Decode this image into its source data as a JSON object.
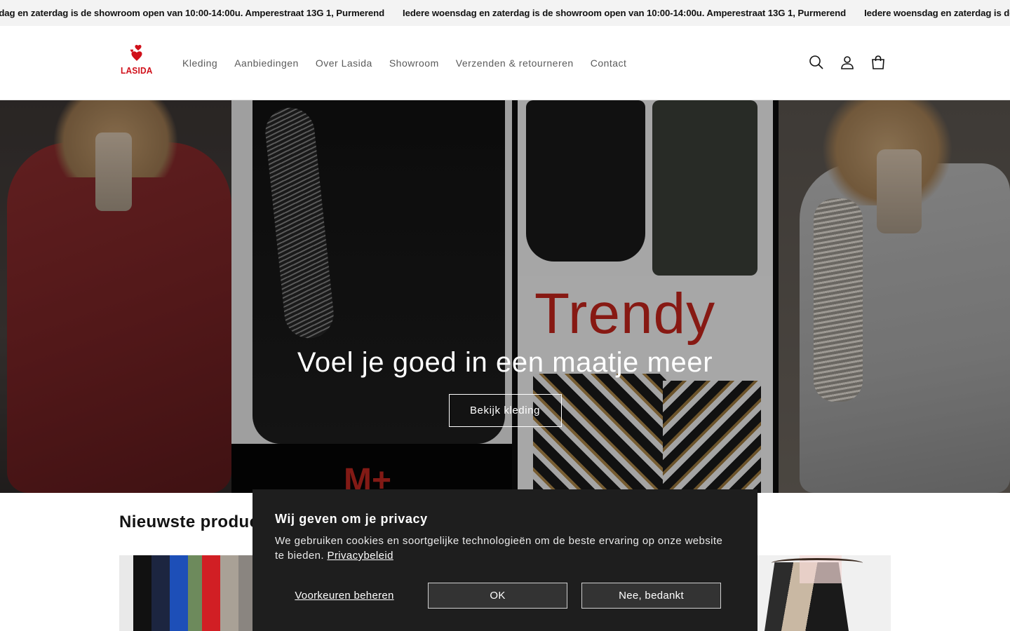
{
  "announcement": {
    "message": "Iedere woensdag en zaterdag is de showroom open van 10:00-14:00u. Amperestraat 13G 1, Purmerend"
  },
  "header": {
    "logo_text": "LASIDA",
    "nav": [
      "Kleding",
      "Aanbiedingen",
      "Over Lasida",
      "Showroom",
      "Verzenden & retourneren",
      "Contact"
    ],
    "icons": [
      "search-icon",
      "account-icon",
      "cart-icon"
    ]
  },
  "hero": {
    "title": "Voel je goed in een maatje meer",
    "button": "Bekijk kleding",
    "image_text_trendy": "Trendy",
    "image_text_mplus": "M+"
  },
  "products": {
    "section_title": "Nieuwste producten"
  },
  "cookie": {
    "title": "Wij geven om je privacy",
    "text": "We gebruiken cookies en soortgelijke technologieën om de beste ervaring op onze website te bieden.",
    "link": "Privacybeleid",
    "preferences": "Voorkeuren beheren",
    "accept": "OK",
    "decline": "Nee, bedankt"
  },
  "colors": {
    "brand_red": "#d0101a",
    "cookie_bg": "#1e1e1e",
    "announcement_bg": "#f3f3f3"
  }
}
